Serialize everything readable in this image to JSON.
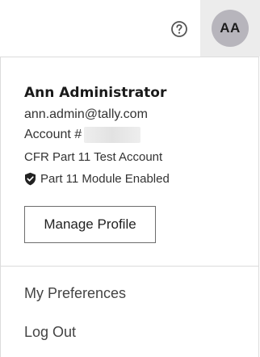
{
  "header": {
    "help_icon": "question-circle-icon",
    "avatar_initials": "AA"
  },
  "profile": {
    "name": "Ann Administrator",
    "email": "ann.admin@tally.com",
    "account_label": "Account #",
    "account_name": "CFR Part 11 Test Account",
    "module_icon": "shield-check-icon",
    "module_status": "Part 11 Module Enabled",
    "manage_button": "Manage Profile"
  },
  "menu": {
    "items": [
      {
        "label": "My Preferences"
      },
      {
        "label": "Log Out"
      }
    ]
  }
}
